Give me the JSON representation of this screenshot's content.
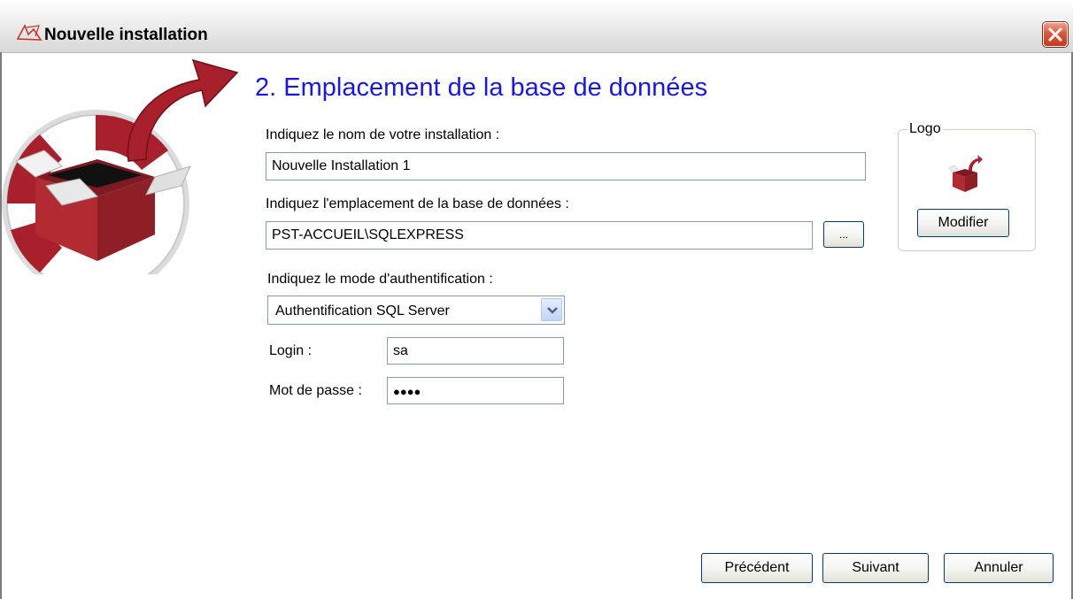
{
  "window": {
    "title": "Nouvelle installation"
  },
  "page": {
    "heading": "2. Emplacement de la base de données"
  },
  "form": {
    "name_label": "Indiquez le nom de votre installation :",
    "name_value": "Nouvelle Installation 1",
    "db_label": "Indiquez l'emplacement de la base de données :",
    "db_value": "PST-ACCUEIL\\SQLEXPRESS",
    "browse_label": "...",
    "auth_label": "Indiquez le mode d'authentification :",
    "auth_selected": "Authentification SQL Server",
    "login_label": "Login :",
    "login_value": "sa",
    "password_label": "Mot de passe :",
    "password_value": "●●●●"
  },
  "logo_group": {
    "legend": "Logo",
    "modify_label": "Modifier"
  },
  "footer": {
    "prev_label": "Précédent",
    "next_label": "Suivant",
    "cancel_label": "Annuler"
  },
  "icons": {
    "title_icon": "app-logo-icon",
    "close": "close-icon",
    "dropdown": "chevron-down-icon"
  },
  "colors": {
    "heading": "#1a1ad6",
    "brand_red": "#a8202c",
    "close_button": "#d9573a"
  }
}
